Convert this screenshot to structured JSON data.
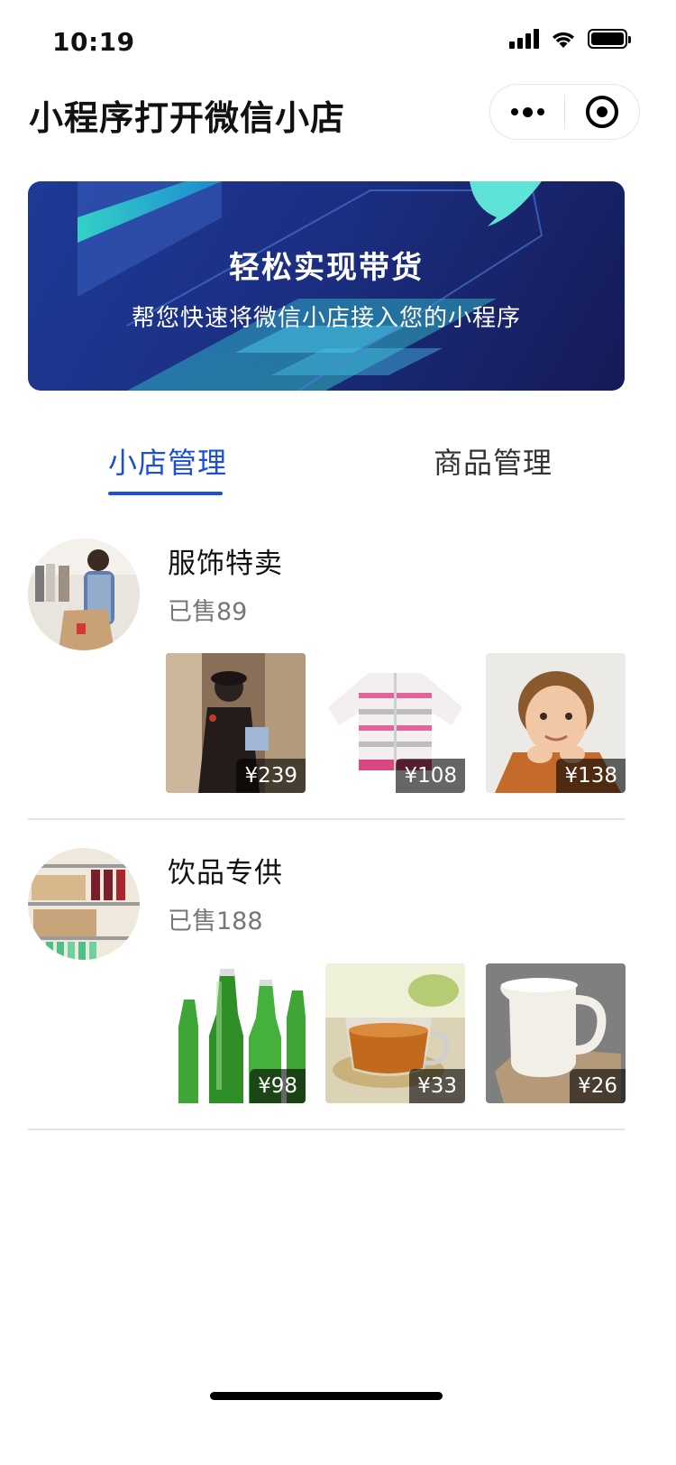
{
  "status_bar": {
    "time": "10:19",
    "battery_level": 1.0
  },
  "nav": {
    "title": "小程序打开微信小店"
  },
  "banner": {
    "title": "轻松实现带货",
    "subtitle": "帮您快速将微信小店接入您的小程序"
  },
  "tabs": [
    {
      "label": "小店管理",
      "active": true
    },
    {
      "label": "商品管理",
      "active": false
    }
  ],
  "accent_color": "#1c4fd8",
  "shops": [
    {
      "name": "服饰特卖",
      "sold": "已售89",
      "avatar_icon": "clothing-store-photo",
      "products": [
        {
          "price": "¥239",
          "image_icon": "woman-shopping-photo"
        },
        {
          "price": "¥108",
          "image_icon": "baby-sweater-photo"
        },
        {
          "price": "¥138",
          "image_icon": "boy-portrait-photo"
        }
      ]
    },
    {
      "name": "饮品专供",
      "sold": "已售188",
      "avatar_icon": "drink-shelf-photo",
      "products": [
        {
          "price": "¥98",
          "image_icon": "green-bottles-photo"
        },
        {
          "price": "¥33",
          "image_icon": "tea-cup-photo"
        },
        {
          "price": "¥26",
          "image_icon": "milk-jug-photo"
        }
      ]
    }
  ]
}
